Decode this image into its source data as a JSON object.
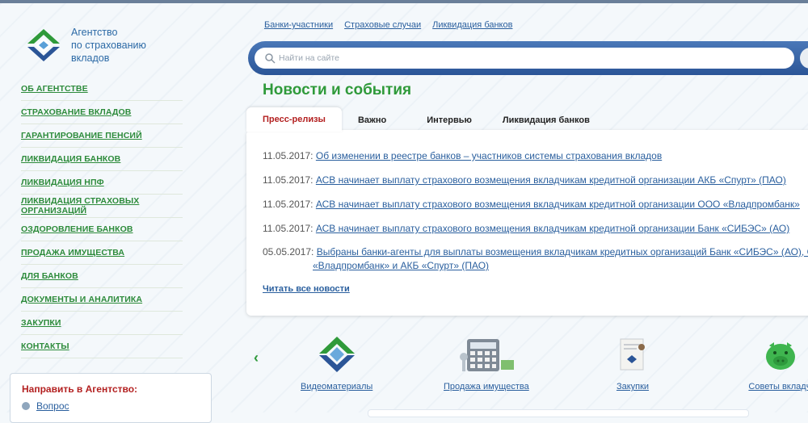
{
  "logo": {
    "line1": "Агентство",
    "line2": "по страхованию",
    "line3": "вкладов"
  },
  "sidebar": {
    "items": [
      "ОБ АГЕНТСТВЕ",
      "СТРАХОВАНИЕ ВКЛАДОВ",
      "ГАРАНТИРОВАНИЕ ПЕНСИЙ",
      "ЛИКВИДАЦИЯ БАНКОВ",
      "ЛИКВИДАЦИЯ НПФ",
      "ЛИКВИДАЦИЯ СТРАХОВЫХ ОРГАНИЗАЦИЙ",
      "ОЗДОРОВЛЕНИЕ БАНКОВ",
      "ПРОДАЖА ИМУЩЕСТВА",
      "ДЛЯ БАНКОВ",
      "ДОКУМЕНТЫ И АНАЛИТИКА",
      "ЗАКУПКИ",
      "КОНТАКТЫ"
    ]
  },
  "send_box": {
    "title": "Направить в Агентство:",
    "question": "Вопрос"
  },
  "top_links": [
    "Банки-участники",
    "Страховые случаи",
    "Ликвидация банков"
  ],
  "search": {
    "placeholder": "Найти на сайте"
  },
  "heading": "Новости и события",
  "tabs": [
    "Пресс-релизы",
    "Важно",
    "Интервью",
    "Ликвидация банков"
  ],
  "news": [
    {
      "date": "11.05.2017:",
      "text": "Об изменении в реестре банков – участников системы страхования вкладов"
    },
    {
      "date": "11.05.2017:",
      "text": "АСВ начинает выплату страхового возмещения вкладчикам кредитной организации АКБ «Спурт» (ПАО)"
    },
    {
      "date": "11.05.2017:",
      "text": "АСВ начинает выплату страхового возмещения вкладчикам кредитной организации ООО «Владпромбанк»"
    },
    {
      "date": "11.05.2017:",
      "text": "АСВ начинает выплату страхового возмещения вкладчикам кредитной организации Банк «СИБЭС» (АО)"
    },
    {
      "date": "05.05.2017:",
      "text": "Выбраны банки-агенты для выплаты возмещения вкладчикам кредитных организаций Банк «СИБЭС» (АО), ООО",
      "text2": "«Владпромбанк» и АКБ «Спурт» (ПАО)"
    }
  ],
  "read_all": "Читать все новости",
  "carousel": [
    "Видеоматериалы",
    "Продажа имущества",
    "Закупки",
    "Советы вкладчи"
  ],
  "colors": {
    "brand_green": "#2f9a3a",
    "brand_blue": "#2b5597",
    "link": "#2a5f9e",
    "accent_red": "#b32020"
  }
}
